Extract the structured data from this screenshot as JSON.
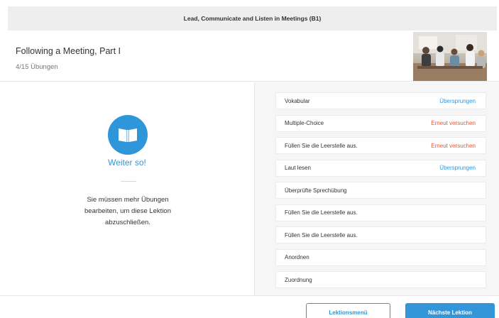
{
  "course": {
    "title": "Lead, Communicate and Listen in Meetings (B1)"
  },
  "lesson": {
    "title": "Following a Meeting, Part I",
    "progress": "4/15 Übungen"
  },
  "result": {
    "icon": "open-book-icon",
    "praise": "Weiter so!",
    "message": "Sie müssen mehr Übungen bearbeiten, um diese Lektion abzuschließen."
  },
  "exercises": [
    {
      "name": "Vokabular",
      "status": "Übersprungen",
      "status_type": "skipped"
    },
    {
      "name": "Multiple-Choice",
      "status": "Erneut versuchen",
      "status_type": "retry"
    },
    {
      "name": "Füllen Sie die Leerstelle aus.",
      "status": "Erneut versuchen",
      "status_type": "retry"
    },
    {
      "name": "Laut lesen",
      "status": "Übersprungen",
      "status_type": "skipped"
    },
    {
      "name": "Überprüfte Sprechübung",
      "status": "",
      "status_type": ""
    },
    {
      "name": "Füllen Sie die Leerstelle aus.",
      "status": "",
      "status_type": ""
    },
    {
      "name": "Füllen Sie die Leerstelle aus.",
      "status": "",
      "status_type": ""
    },
    {
      "name": "Anordnen",
      "status": "",
      "status_type": ""
    },
    {
      "name": "Zuordnung",
      "status": "",
      "status_type": ""
    }
  ],
  "footer": {
    "menu_label": "Lektionsmenü",
    "next_label": "Nächste Lektion"
  },
  "colors": {
    "accent": "#2f96d9",
    "retry": "#e55637",
    "topbar_bg": "#eeeeef",
    "panel_bg": "#f6f6f6"
  }
}
